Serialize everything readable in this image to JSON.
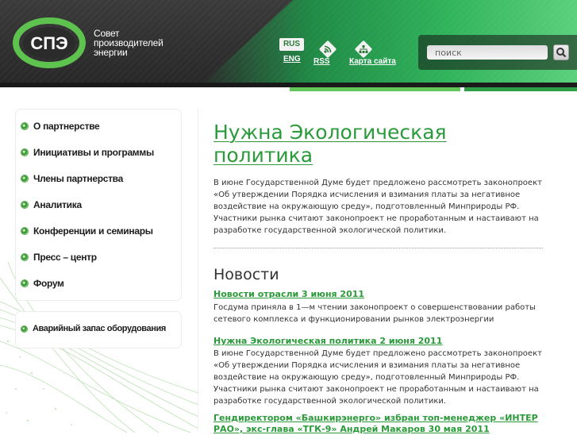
{
  "header": {
    "logo_lines": [
      "Совет",
      "производителей",
      "энергии"
    ],
    "logo_mark_text": "СПЭ",
    "lang_rus": "RUS",
    "lang_eng": "ENG",
    "rss_label": "RSS",
    "sitemap_label": "Карта сайта",
    "search_placeholder": "поиск"
  },
  "sidebar": {
    "items": [
      {
        "label": "О партнерстве"
      },
      {
        "label": "Инициативы и программы"
      },
      {
        "label": "Члены партнерства"
      },
      {
        "label": "Аналитика"
      },
      {
        "label": "Конференции и семинары"
      },
      {
        "label": "Пресс – центр"
      },
      {
        "label": "Форум"
      }
    ],
    "emergency": "Аварийный запас оборудования"
  },
  "main": {
    "title": "Нужна Экологическая политика",
    "lead": "В июне Государственной Думе будет предложено рассмотреть законопроект «Об утверждении Порядка исчисления и взимания платы за негативное воздействие на окружающую среду», подготовленный Минприроды РФ. Участники рынка считают законопроект не проработанным и настаивают на разработке государственной экологической политики.",
    "news_heading": "Новости",
    "news": [
      {
        "title": "Новости отрасли  3 июня 2011",
        "text": "Госдума приняла в 1—м чтении законопроект о совершенствовании работы сетевого комплекса и функционировании рынков электроэнергии"
      },
      {
        "title": "Нужна Экологическая политика  2 июня 2011",
        "text": "В июне Государственной Думе будет предложено рассмотреть законопроект «Об утверждении Порядка исчисления и взимания платы за негативное воздействие на окружающую среду», подготовленный Минприроды РФ. Участники рынка считают законопроект не проработанным и настаивают на разработке государственной экологической политики."
      },
      {
        "title": "Гендиректором «Башкирэнерго» избран топ-менеджер «ИНТЕР РАО», экс-глава «ТГК-9» Андрей Макаров  30 мая 2011",
        "text": ""
      }
    ]
  },
  "colors": {
    "accent_green": "#2a9a3a",
    "header_dark": "#2b2b2b",
    "header_green": "#2fb25a"
  }
}
